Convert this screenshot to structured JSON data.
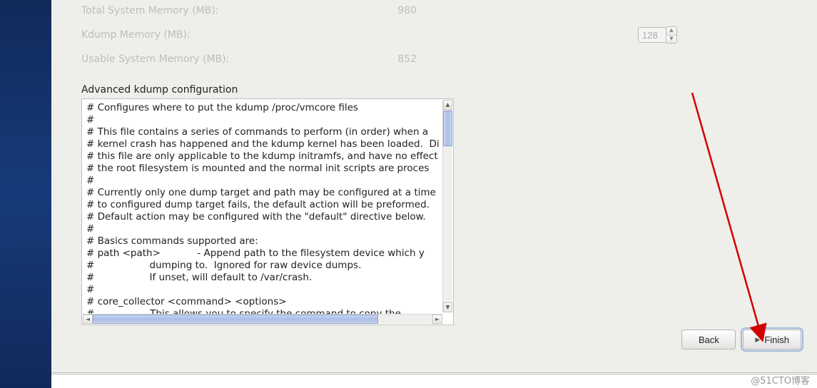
{
  "memory": {
    "total_label": "Total System Memory (MB):",
    "total_value": "980",
    "kdump_label": "Kdump Memory (MB):",
    "kdump_value": "128",
    "usable_label": "Usable System Memory (MB):",
    "usable_value": "852"
  },
  "advanced": {
    "title": "Advanced kdump configuration",
    "config_text": "# Configures where to put the kdump /proc/vmcore files\n#\n# This file contains a series of commands to perform (in order) when a\n# kernel crash has happened and the kdump kernel has been loaded.  Di\n# this file are only applicable to the kdump initramfs, and have no effect\n# the root filesystem is mounted and the normal init scripts are proces\n#\n# Currently only one dump target and path may be configured at a time\n# to configured dump target fails, the default action will be preformed.\n# Default action may be configured with the \"default\" directive below.\n#\n# Basics commands supported are:\n# path <path>            - Append path to the filesystem device which y\n#                  dumping to.  Ignored for raw device dumps.\n#                  If unset, will default to /var/crash.\n#\n# core_collector <command> <options>\n#                - This allows you to specify the command to copy the"
  },
  "buttons": {
    "back": "Back",
    "finish": "Finish"
  },
  "watermark": "@51CTO博客"
}
